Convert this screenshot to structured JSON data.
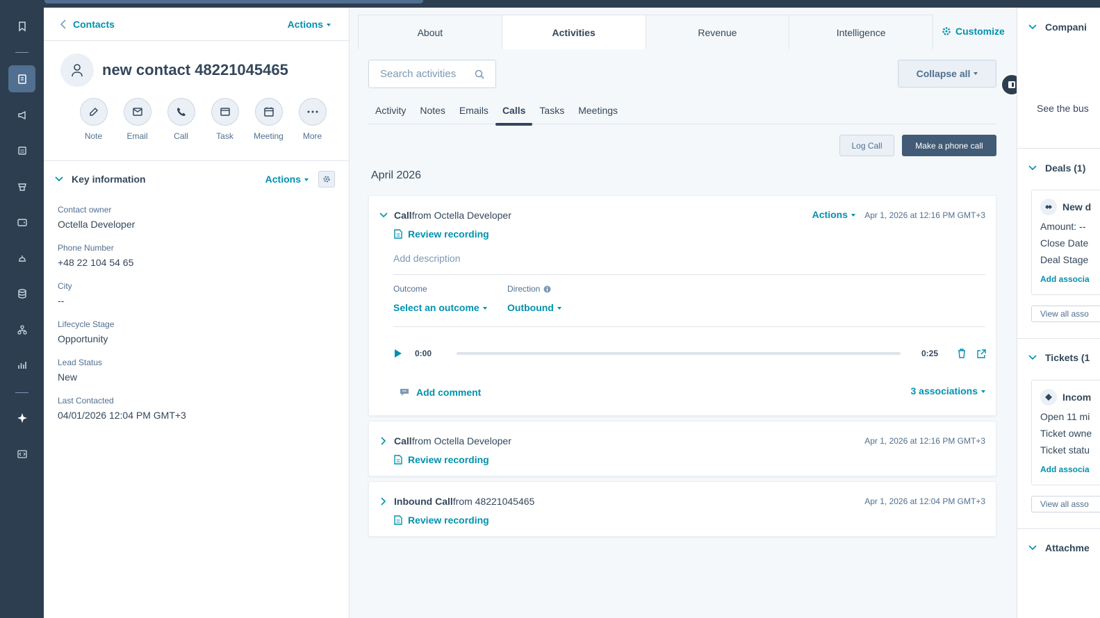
{
  "colors": {
    "nav_bg": "#2d3e50",
    "accent": "#0091ae",
    "text": "#33475b",
    "primary_button": "#425b76"
  },
  "nav": {
    "icons": [
      "bookmark-icon",
      "contacts-icon",
      "megaphone-icon",
      "document-icon",
      "commerce-icon",
      "wallet-icon",
      "service-bell-icon",
      "database-icon",
      "org-chart-icon",
      "reports-icon",
      "sparkle-icon",
      "code-icon"
    ]
  },
  "left_panel": {
    "back_label": "Contacts",
    "actions_label": "Actions",
    "contact_name": "new contact 48221045465",
    "quick_actions": [
      "Note",
      "Email",
      "Call",
      "Task",
      "Meeting",
      "More"
    ],
    "key_info": {
      "title": "Key information",
      "actions_label": "Actions",
      "properties": [
        {
          "label": "Contact owner",
          "value": "Octella Developer"
        },
        {
          "label": "Phone Number",
          "value": "+48 22 104 54 65"
        },
        {
          "label": "City",
          "value": "--"
        },
        {
          "label": "Lifecycle Stage",
          "value": "Opportunity"
        },
        {
          "label": "Lead Status",
          "value": "New"
        },
        {
          "label": "Last Contacted",
          "value": "04/01/2026 12:04 PM GMT+3"
        }
      ]
    }
  },
  "main": {
    "tabs": [
      "About",
      "Activities",
      "Revenue",
      "Intelligence"
    ],
    "active_tab": "Activities",
    "customize_label": "Customize",
    "search_placeholder": "Search activities",
    "collapse_label": "Collapse all",
    "subtabs": [
      "Activity",
      "Notes",
      "Emails",
      "Calls",
      "Tasks",
      "Meetings"
    ],
    "active_subtab": "Calls",
    "log_call_label": "Log Call",
    "make_call_label": "Make a phone call",
    "month": "April 2026",
    "calls": [
      {
        "title_bold": "Call",
        "title_rest": " from Octella Developer",
        "actions_label": "Actions",
        "time": "Apr 1, 2026 at 12:16 PM GMT+3",
        "review_label": "Review recording",
        "description_placeholder": "Add description",
        "outcome_label": "Outcome",
        "outcome_value": "Select an outcome",
        "direction_label": "Direction",
        "direction_value": "Outbound",
        "player_start": "0:00",
        "player_end": "0:25",
        "comment_label": "Add comment",
        "associations_label": "3 associations"
      },
      {
        "title_bold": "Call",
        "title_rest": " from Octella Developer",
        "time": "Apr 1, 2026 at 12:16 PM GMT+3",
        "review_label": "Review recording"
      },
      {
        "title_bold": "Inbound Call",
        "title_rest": " from 48221045465",
        "time": "Apr 1, 2026 at 12:04 PM GMT+3",
        "review_label": "Review recording"
      }
    ]
  },
  "right_panel": {
    "companies_title": "Compani",
    "companies_text": "See the bus",
    "deals_title": "Deals (1)",
    "deal_name": "New d",
    "deal_amount": "Amount: --",
    "deal_close": "Close Date",
    "deal_stage": "Deal Stage",
    "deal_add": "Add associa",
    "deal_view_all": "View all asso",
    "tickets_title": "Tickets (1",
    "ticket_name": "Incom",
    "ticket_open": "Open 11 mi",
    "ticket_owner": "Ticket owne",
    "ticket_status": "Ticket statu",
    "ticket_add": "Add associa",
    "ticket_view_all": "View all asso",
    "attachments_title": "Attachme"
  }
}
